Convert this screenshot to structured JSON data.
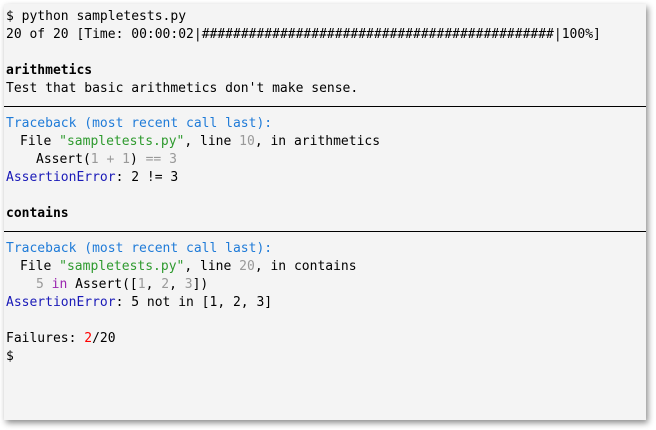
{
  "command": {
    "prompt": "$",
    "text": "python sampletests.py"
  },
  "progress": {
    "count_text": "20 of 20",
    "time_label": "[Time: 00:00:02|",
    "bar": "#############################################",
    "percent": "|100%]",
    "value": 1.0
  },
  "tests": [
    {
      "name": "arithmetics",
      "doc": "Test that basic arithmetics don't make sense.",
      "traceback_header": "Traceback (most recent call last):",
      "file_prefix": "File ",
      "file_name": "\"sampletests.py\"",
      "line_text": ", line ",
      "line_no": "10",
      "in_text": ", in arithmetics",
      "code": {
        "p1": "Assert(",
        "n1": "1",
        "op1": " + ",
        "n2": "1",
        "p2": ") ",
        "op2": "==",
        "p3": " ",
        "n3": "3"
      },
      "error_name": "AssertionError",
      "error_msg": ": 2 != 3"
    },
    {
      "name": "contains",
      "traceback_header": "Traceback (most recent call last):",
      "file_prefix": "File ",
      "file_name": "\"sampletests.py\"",
      "line_text": ", line ",
      "line_no": "20",
      "in_text": ", in contains",
      "code": {
        "n1": "5",
        "kw": "in",
        "p1": " Assert([",
        "n2": "1",
        "p2": ", ",
        "n3": "2",
        "p3": ", ",
        "n4": "3",
        "p4": "])"
      },
      "error_name": "AssertionError",
      "error_msg": ": 5 not in [1, 2, 3]"
    }
  ],
  "summary": {
    "label": "Failures: ",
    "failed": "2",
    "total": "/20"
  },
  "final_prompt": "$",
  "colors": {
    "traceback": "#1f7bd8",
    "string": "#2e9a2e",
    "number": "#999999",
    "keyword": "#9b27b0",
    "error": "#1a1ab8",
    "failure_count": "#ff0000"
  }
}
